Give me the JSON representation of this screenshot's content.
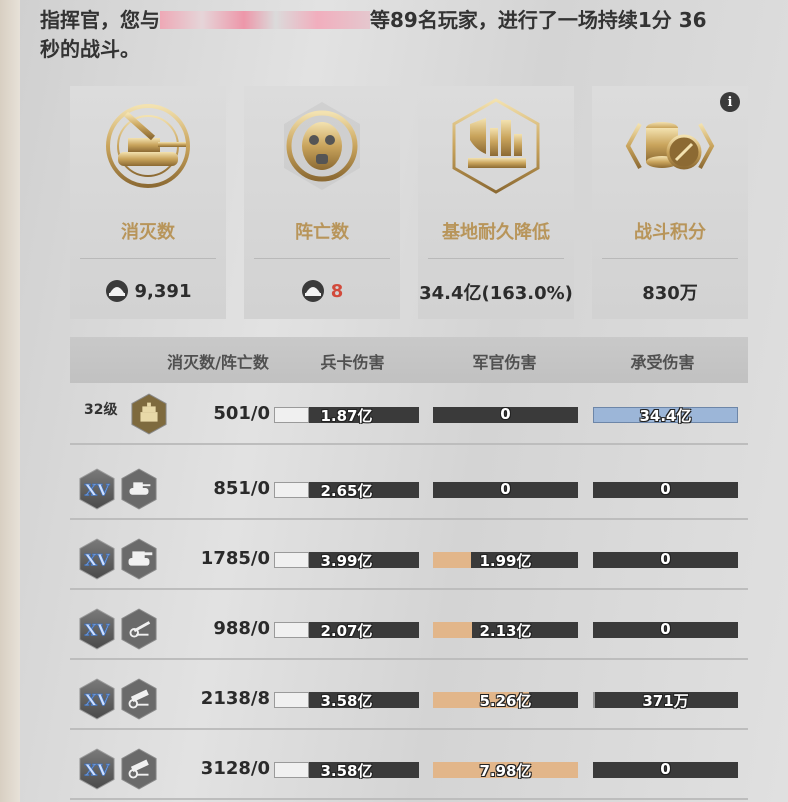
{
  "header": {
    "line_start": "指挥官，您与",
    "line_end": "等89名玩家，进行了一场持续1分 36",
    "line2": "秒的战斗。"
  },
  "stats": [
    {
      "label": "消灭数",
      "value": "9,391",
      "icon": "tank-kill-emblem",
      "value_icon": "helmet-icon",
      "value_color": "#2c2c2c"
    },
    {
      "label": "阵亡数",
      "value": "8",
      "icon": "gasmask-target-emblem",
      "value_icon": "helmet-icon",
      "value_color": "#d24a3b"
    },
    {
      "label": "基地耐久降低",
      "value": "34.4亿(163.0%)",
      "icon": "base-shield-emblem",
      "value_color": "#2c2c2c"
    },
    {
      "label": "战斗积分",
      "value": "830万",
      "icon": "coin-stack-emblem",
      "value_color": "#2c2c2c",
      "info": "i"
    }
  ],
  "table": {
    "headers": [
      "消灭数/阵亡数",
      "兵卡伤害",
      "军官伤害",
      "承受伤害"
    ],
    "rows": [
      {
        "level": "32级",
        "unit_icon": "building-icon",
        "kd": "501/0",
        "troop": {
          "text": "1.87亿",
          "fill": 0.24
        },
        "officer": {
          "text": "0",
          "fill": 0
        },
        "taken": {
          "text": "34.4亿",
          "fill": 1.0,
          "color": "blue"
        }
      },
      {
        "rank": "XV",
        "unit_icon": "tank-icon",
        "kd": "851/0",
        "troop": {
          "text": "2.65亿",
          "fill": 0.24
        },
        "officer": {
          "text": "0",
          "fill": 0
        },
        "taken": {
          "text": "0",
          "fill": 0
        }
      },
      {
        "rank": "XV",
        "unit_icon": "heavy-tank-icon",
        "kd": "1785/0",
        "troop": {
          "text": "3.99亿",
          "fill": 0.24
        },
        "officer": {
          "text": "1.99亿",
          "fill": 0.26,
          "color": "tan"
        },
        "taken": {
          "text": "0",
          "fill": 0
        }
      },
      {
        "rank": "XV",
        "unit_icon": "artillery-icon",
        "kd": "988/0",
        "troop": {
          "text": "2.07亿",
          "fill": 0.24
        },
        "officer": {
          "text": "2.13亿",
          "fill": 0.27,
          "color": "tan"
        },
        "taken": {
          "text": "0",
          "fill": 0
        }
      },
      {
        "rank": "XV",
        "unit_icon": "rocket-launcher-icon",
        "kd": "2138/8",
        "troop": {
          "text": "3.58亿",
          "fill": 0.24
        },
        "officer": {
          "text": "5.26亿",
          "fill": 0.66,
          "color": "tan"
        },
        "taken": {
          "text": "371万",
          "fill": 0.01
        }
      },
      {
        "rank": "XV",
        "unit_icon": "rocket-launcher-icon",
        "kd": "3128/0",
        "troop": {
          "text": "3.58亿",
          "fill": 0.24
        },
        "officer": {
          "text": "7.98亿",
          "fill": 1.0,
          "color": "tan"
        },
        "taken": {
          "text": "0",
          "fill": 0
        }
      }
    ]
  }
}
